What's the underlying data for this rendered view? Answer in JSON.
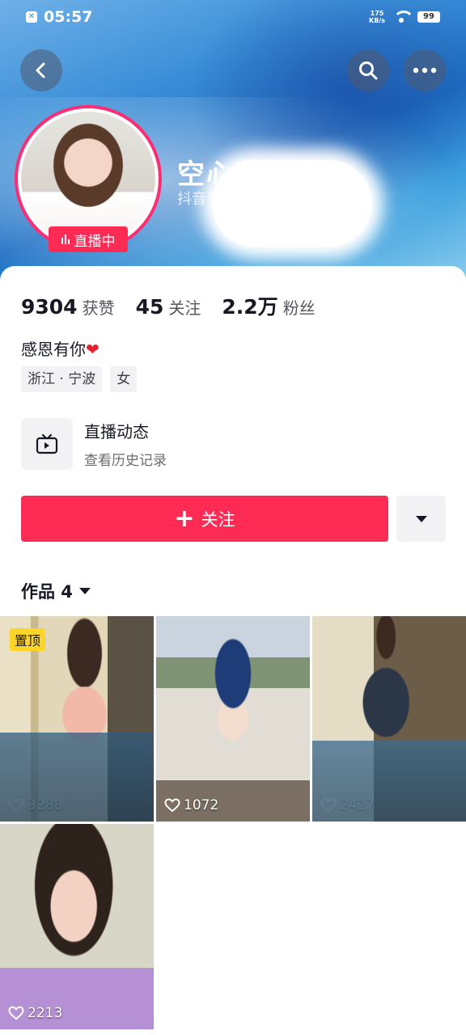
{
  "status_bar": {
    "time": "05:57",
    "speed_top": "175",
    "speed_unit": "KB/s",
    "battery": "99"
  },
  "profile": {
    "nickname": "空心菜",
    "id_label": "抖音号",
    "live_badge": "直播中",
    "stats": [
      {
        "value": "9304",
        "label": "获赞"
      },
      {
        "value": "45",
        "label": "关注"
      },
      {
        "value": "2.2万",
        "label": "粉丝"
      }
    ],
    "bio": "感恩有你",
    "bio_emoji": "❤",
    "tags": [
      "浙江 · 宁波",
      "女"
    ]
  },
  "live_dynamic": {
    "title": "直播动态",
    "subtitle": "查看历史记录"
  },
  "actions": {
    "follow_label": "关注",
    "follow_icon": "+"
  },
  "works": {
    "tab_label": "作品 4",
    "items": [
      {
        "likes": "3288",
        "pinned_label": "置顶"
      },
      {
        "likes": "1072"
      },
      {
        "likes": "2427"
      },
      {
        "likes": "2213"
      }
    ]
  },
  "colors": {
    "accent": "#fe2c55",
    "live_ring": "#fe2c72",
    "pin": "#fdd428"
  }
}
